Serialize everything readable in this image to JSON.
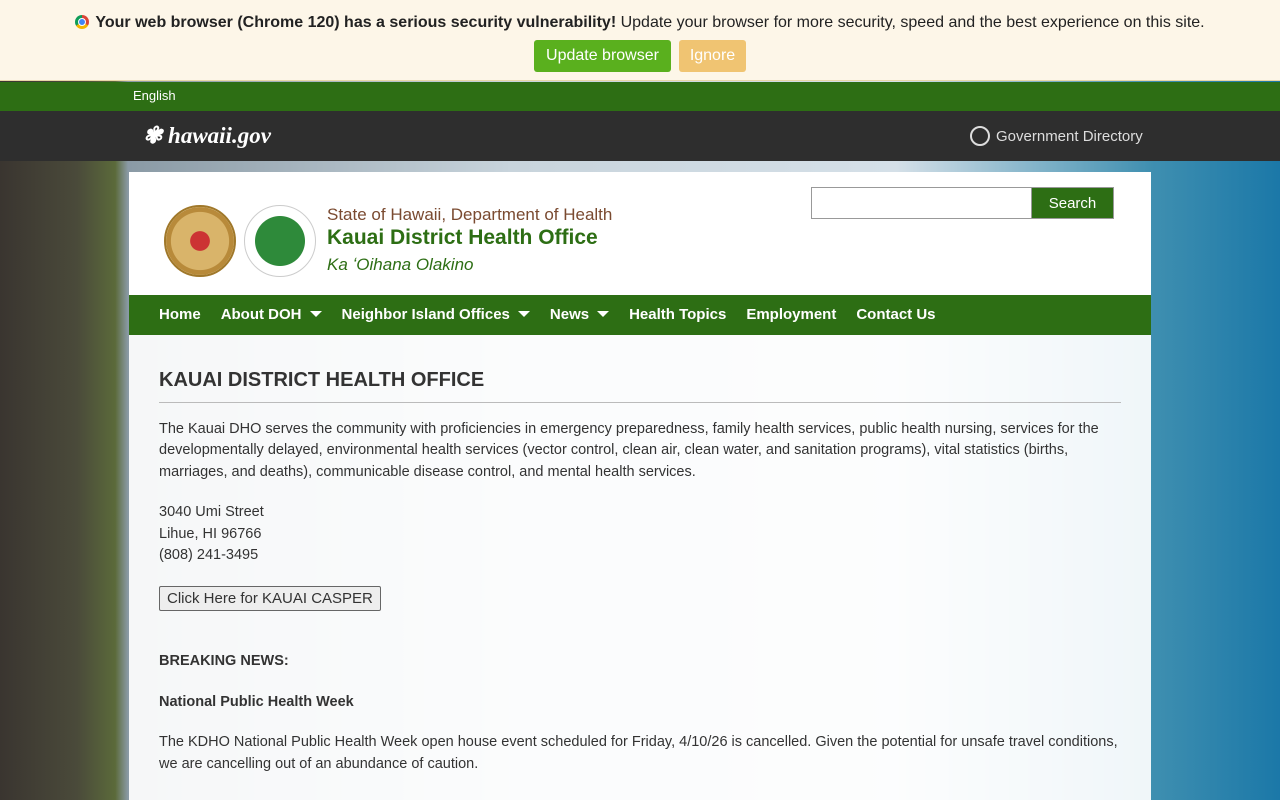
{
  "banner": {
    "bold": "Your web browser (Chrome 120) has a serious security vulnerability!",
    "text": " Update your browser for more security, speed and the best experience on this site.",
    "update": "Update browser",
    "ignore": "Ignore"
  },
  "lang": "English",
  "gov": {
    "logo": "hawaii.gov",
    "directory": "Government Directory"
  },
  "header": {
    "dept": "State of Hawaii, Department of Health",
    "office": "Kauai District Health Office",
    "tagline": "Ka ʻOihana Olakino",
    "search": "Search"
  },
  "nav": [
    "Home",
    "About DOH",
    "Neighbor Island Offices",
    "News",
    "Health Topics",
    "Employment",
    "Contact Us"
  ],
  "content": {
    "title": "KAUAI DISTRICT HEALTH OFFICE",
    "intro": "The Kauai DHO serves the community with proficiencies in emergency preparedness, family health services, public health nursing, services for the developmentally delayed, environmental health services (vector control, clean air, clean water, and sanitation programs), vital statistics (births, marriages, and deaths), communicable disease control, and mental health services.",
    "address1": "3040 Umi Street",
    "address2": "Lihue, HI 96766",
    "phone": "(808) 241-3495",
    "casper": "Click Here for KAUAI CASPER",
    "breaking": "BREAKING NEWS:",
    "news_title": "National Public Health Week",
    "news_body": "The KDHO National Public Health Week open house event scheduled for Friday, 4/10/26 is cancelled.   Given the potential for unsafe travel conditions, we are cancelling out of an abundance of caution."
  }
}
